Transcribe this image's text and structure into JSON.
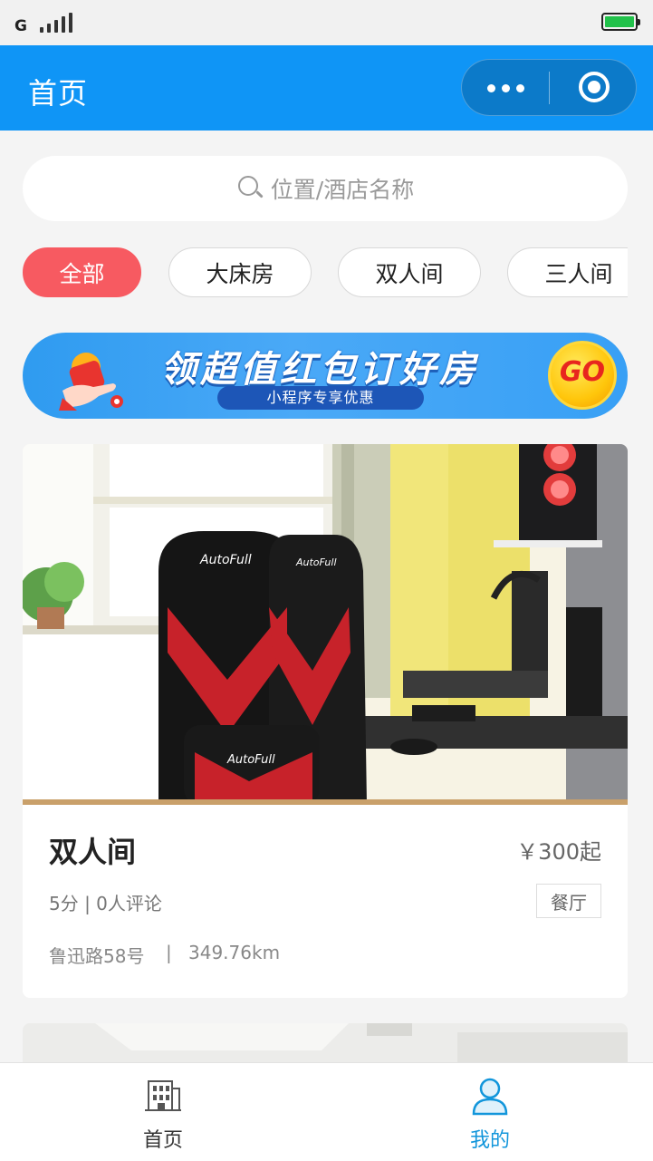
{
  "status_bar": {
    "network": "G"
  },
  "nav": {
    "title": "首页"
  },
  "search": {
    "placeholder": "位置/酒店名称"
  },
  "tags": [
    {
      "label": "全部",
      "active": true
    },
    {
      "label": "大床房",
      "active": false
    },
    {
      "label": "双人间",
      "active": false
    },
    {
      "label": "三人间",
      "active": false
    }
  ],
  "banner": {
    "title": "领超值红包订好房",
    "subtitle": "小程序专享优惠",
    "go_label": "GO"
  },
  "listing": {
    "name": "双人间",
    "price": "￥300起",
    "rating": "5分 | 0人评论",
    "facility": "餐厅",
    "address": "鲁迅路58号",
    "separator": "|",
    "distance": "349.76km",
    "photo_chair_brand": "AutoFull"
  },
  "tabbar": {
    "items": [
      {
        "label": "首页",
        "icon": "building-icon",
        "active": false
      },
      {
        "label": "我的",
        "icon": "user-icon",
        "active": true
      }
    ]
  },
  "colors": {
    "brand": "#0f95f6",
    "tag_active": "#f75a61",
    "tab_active": "#1296db",
    "battery": "#21c14a"
  }
}
